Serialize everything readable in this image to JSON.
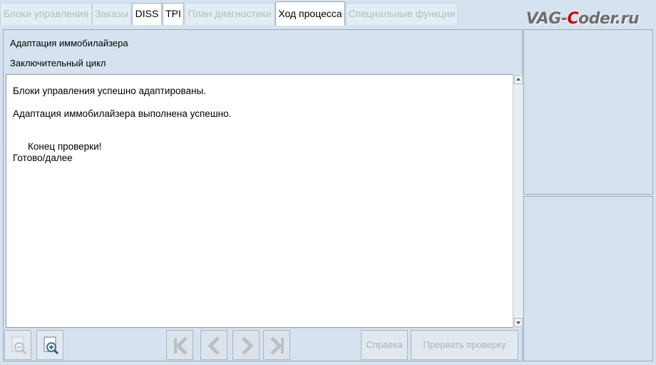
{
  "tabs": [
    {
      "label": "Блоки управления",
      "state": "disabled"
    },
    {
      "label": "Заказы",
      "state": "disabled"
    },
    {
      "label": "DISS",
      "state": "enabled"
    },
    {
      "label": "TPI",
      "state": "enabled"
    },
    {
      "label": "План диагностики",
      "state": "disabled"
    },
    {
      "label": "Ход процесса",
      "state": "active"
    },
    {
      "label": "Специальные функции",
      "state": "disabled"
    }
  ],
  "logo": {
    "prefix": "VAG-",
    "c": "C",
    "suffix": "oder.ru"
  },
  "header": {
    "title": "Адаптация иммобилайзера",
    "subtitle": "Заключительный цикл"
  },
  "content": {
    "line1": "Блоки управления успешно адаптированы.",
    "line2": "Адаптация иммобилайзера выполнена успешно.",
    "line3": "Конец проверки!",
    "line4": "Готово/далее"
  },
  "toolbar": {
    "help_label": "Справка",
    "abort_label": "Прервать проверку"
  },
  "icons": {
    "zoom_out": "zoom-out-icon",
    "zoom_in": "zoom-in-icon",
    "first": "first-page-icon",
    "prev": "previous-icon",
    "next": "next-icon",
    "last": "last-page-icon"
  },
  "colors": {
    "background": "#d6e2ef",
    "logo_accent": "#d20000"
  }
}
